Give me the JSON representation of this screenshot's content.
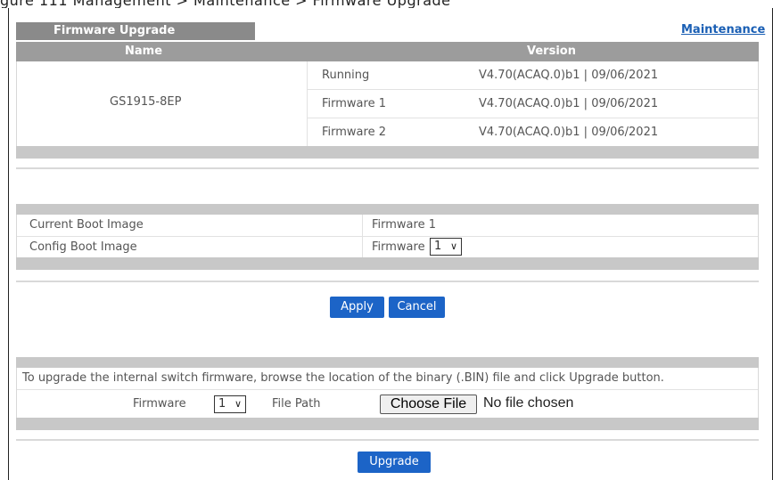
{
  "caption_fragment": "gure 111 Management > Maintenance > Firmware Upgrade",
  "tab": {
    "label": "Firmware Upgrade"
  },
  "maintenance_link": "Maintenance",
  "version_table": {
    "headers": {
      "name": "Name",
      "version": "Version"
    },
    "device_name": "GS1915-8EP",
    "rows": [
      {
        "label": "Running",
        "value": "V4.70(ACAQ.0)b1  |  09/06/2021"
      },
      {
        "label": "Firmware 1",
        "value": "V4.70(ACAQ.0)b1  |  09/06/2021"
      },
      {
        "label": "Firmware 2",
        "value": "V4.70(ACAQ.0)b1  |  09/06/2021"
      }
    ]
  },
  "boot": {
    "current_label": "Current Boot Image",
    "current_value": "Firmware  1",
    "config_label": "Config Boot Image",
    "config_prefix": "Firmware",
    "config_selected": "1"
  },
  "buttons": {
    "apply": "Apply",
    "cancel": "Cancel",
    "upgrade": "Upgrade"
  },
  "upgrade": {
    "instructions": "To upgrade the internal switch firmware, browse the location of the binary (.BIN) file and click Upgrade button.",
    "firmware_label": "Firmware",
    "firmware_selected": "1",
    "file_path_label": "File Path",
    "choose_file": "Choose File",
    "no_file": "No file chosen"
  },
  "colors": {
    "accent_blue": "#1c64c7",
    "header_gray": "#9c9c9c",
    "link_blue": "#1a5fb4"
  }
}
